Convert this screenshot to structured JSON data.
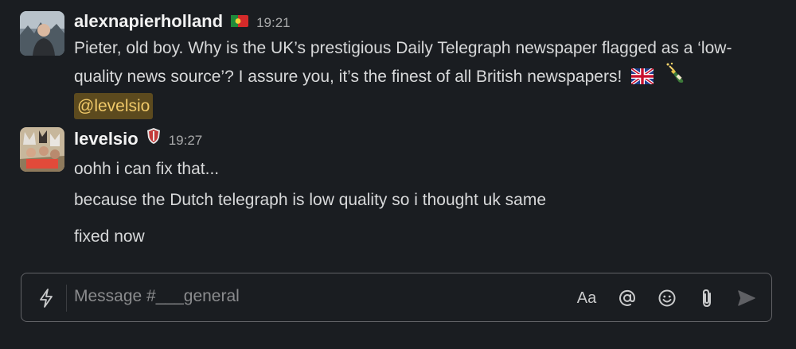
{
  "messages": [
    {
      "username": "alexnapierholland",
      "time": "19:21",
      "lines": [
        "Pieter, old boy. Why is the UK’s prestigious Daily Telegraph newspaper flagged as a ‘low-",
        "quality news source’? I assure you, it’s the finest of all British newspapers!"
      ],
      "mention": "@levelsio",
      "icons": [
        "portugal-flag-icon",
        "uk-flag-icon",
        "champagne-icon"
      ]
    },
    {
      "username": "levelsio",
      "time": "19:27",
      "lines": [
        "oohh i can fix that...",
        "because the Dutch telegraph is low quality so i thought uk same",
        "fixed now"
      ],
      "icons": [
        "status-badge-icon"
      ]
    }
  ],
  "composer": {
    "placeholder": "Message #___general",
    "format_label": "Aa",
    "icons": [
      "bolt-icon",
      "at-icon",
      "emoji-icon",
      "attach-icon",
      "send-icon"
    ]
  }
}
